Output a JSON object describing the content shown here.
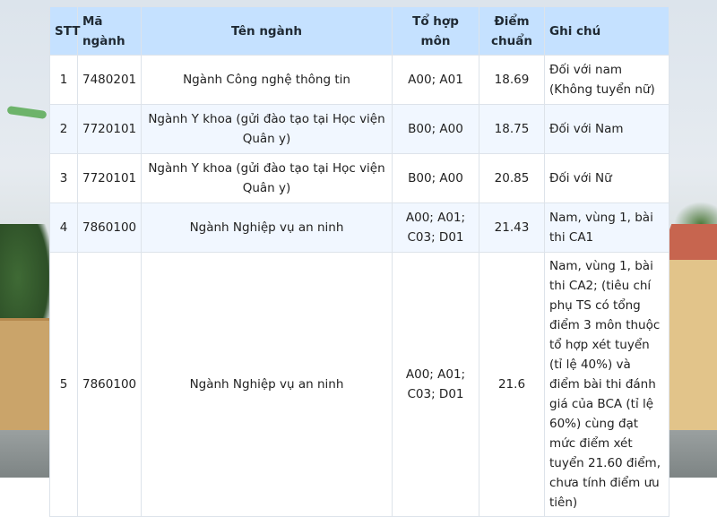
{
  "table": {
    "headers": {
      "stt": "STT",
      "ma_nganh": "Mã ngành",
      "ten_nganh": "Tên ngành",
      "to_hop_mon": "Tổ hợp môn",
      "diem_chuan": "Điểm chuẩn",
      "ghi_chu": "Ghi chú"
    },
    "rows": [
      {
        "stt": "1",
        "ma_nganh": "7480201",
        "ten_nganh": "Ngành Công nghệ thông tin",
        "to_hop_mon": "A00; A01",
        "diem_chuan": "18.69",
        "ghi_chu": "Đối với nam (Không tuyển nữ)"
      },
      {
        "stt": "2",
        "ma_nganh": "7720101",
        "ten_nganh": "Ngành Y khoa (gửi đào tạo tại Học viện Quân y)",
        "to_hop_mon": "B00; A00",
        "diem_chuan": "18.75",
        "ghi_chu": "Đối với Nam"
      },
      {
        "stt": "3",
        "ma_nganh": "7720101",
        "ten_nganh": "Ngành Y khoa (gửi đào tạo tại Học viện Quân y)",
        "to_hop_mon": "B00; A00",
        "diem_chuan": "20.85",
        "ghi_chu": "Đối với Nữ"
      },
      {
        "stt": "4",
        "ma_nganh": "7860100",
        "ten_nganh": "Ngành Nghiệp vụ an ninh",
        "to_hop_mon": "A00; A01; C03; D01",
        "diem_chuan": "21.43",
        "ghi_chu": "Nam, vùng 1, bài thi CA1"
      },
      {
        "stt": "5",
        "ma_nganh": "7860100",
        "ten_nganh": "Ngành Nghiệp vụ an ninh",
        "to_hop_mon": "A00; A01; C03; D01",
        "diem_chuan": "21.6",
        "ghi_chu": "Nam, vùng 1, bài thi CA2; (tiêu chí phụ TS có tổng điểm 3 môn thuộc tổ hợp xét tuyển (tỉ lệ 40%) và điểm bài thi đánh giá của BCA (tỉ lệ 60%) cùng đạt mức điểm xét tuyển 21.60 điểm, chưa tính điểm ưu tiên)"
      }
    ]
  }
}
